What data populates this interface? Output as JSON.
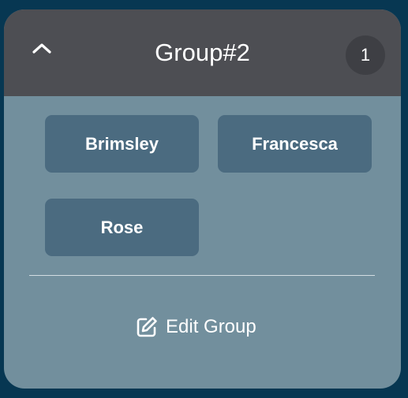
{
  "group": {
    "title": "Group#2",
    "count": "1",
    "collapse_icon": "chevron-up-icon"
  },
  "members": [
    {
      "name": "Brimsley"
    },
    {
      "name": "Francesca"
    },
    {
      "name": "Rose"
    }
  ],
  "actions": {
    "edit_label": "Edit Group",
    "edit_icon": "edit-icon"
  },
  "colors": {
    "page_background": "#073752",
    "header_background": "#4d4e53",
    "card_background": "#728f9d",
    "chip_background": "#4b6b80",
    "badge_background": "#3e3f44",
    "text": "#ffffff"
  }
}
